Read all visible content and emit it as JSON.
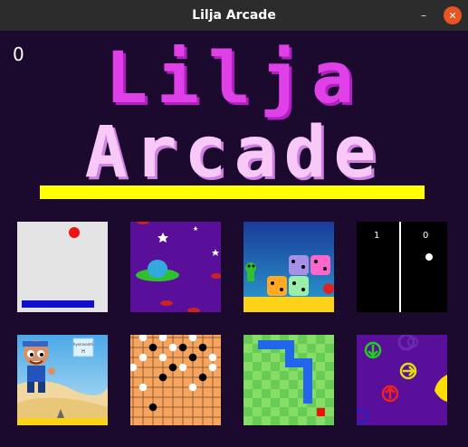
{
  "window": {
    "title": "Lilja Arcade",
    "minimize_glyph": "–",
    "close_glyph": "✕"
  },
  "score": "0",
  "logo": {
    "line1": "Lilja",
    "line2": "Arcade"
  },
  "colors": {
    "background": "#1c0a2e",
    "titlebar": "#2c2c2c",
    "logo_line1": "#e040e8",
    "logo_line2": "#f8c8f8",
    "bar": "#ffff00",
    "close_button": "#e95420"
  },
  "games": [
    {
      "id": "breakout",
      "icon": "breakout-thumbnail"
    },
    {
      "id": "space",
      "icon": "ufo-space-thumbnail"
    },
    {
      "id": "blocks",
      "icon": "creature-blocks-thumbnail"
    },
    {
      "id": "pong",
      "icon": "pong-thumbnail",
      "score_left": "1",
      "score_right": "0"
    },
    {
      "id": "runner",
      "icon": "desert-runner-thumbnail",
      "sign": "hyvinvointi\nH"
    },
    {
      "id": "go",
      "icon": "go-board-thumbnail"
    },
    {
      "id": "snake",
      "icon": "snake-thumbnail"
    },
    {
      "id": "arrows",
      "icon": "arrows-thumbnail"
    }
  ]
}
